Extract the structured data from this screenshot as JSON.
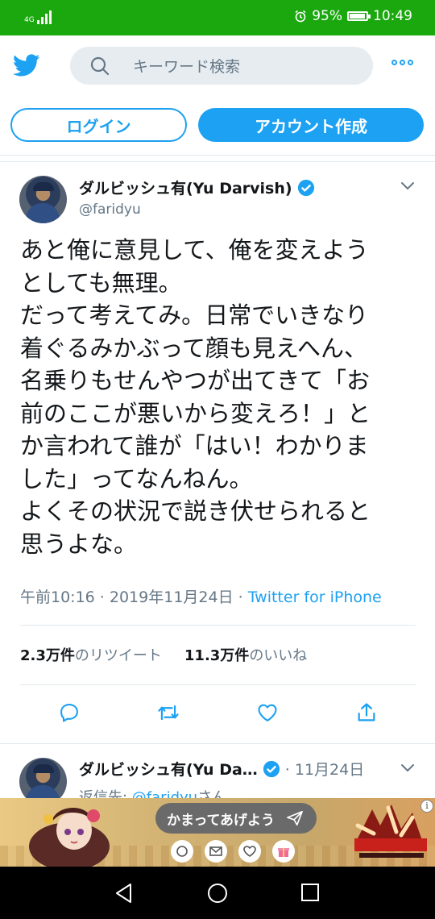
{
  "status_bar": {
    "network": "4G",
    "battery_percent": "95%",
    "battery_level": 0.95,
    "time": "10:49"
  },
  "header": {
    "search_placeholder": "キーワード検索",
    "login_label": "ログイン",
    "signup_label": "アカウント作成"
  },
  "tweet": {
    "author_name": "ダルビッシュ有(Yu Darvish)",
    "handle": "@faridyu",
    "lines": [
      "あと俺に意見して、俺を変えよう",
      "としても無理。",
      "だって考えてみ。日常でいきなり",
      "着ぐるみかぶって顔も見えへん、",
      "名乗りもせんやつが出てきて「お",
      "前のここが悪いから変えろ！」と",
      "か言われて誰が「はい！わかりま",
      "した」ってなんねん。",
      "よくその状況で説き伏せられると",
      "思うよな。"
    ],
    "timestamp": "午前10:16 · 2019年11月24日 · ",
    "source": "Twitter for iPhone",
    "retweets_count": "2.3万件",
    "retweets_label": "のリツイート",
    "likes_count": "11.3万件",
    "likes_label": "のいいね"
  },
  "reply": {
    "author_name": "ダルビッシュ有(Yu Da…",
    "date": "· 11月24日",
    "reply_prefix": "返信先: ",
    "reply_to": "@faridyu",
    "reply_suffix": "さん"
  },
  "ad": {
    "pill_text": "かまってあげよう",
    "info": "i"
  },
  "colors": {
    "status_bar": "#1aa80e",
    "accent": "#1da1f2",
    "text": "#14171a",
    "muted": "#657786"
  }
}
